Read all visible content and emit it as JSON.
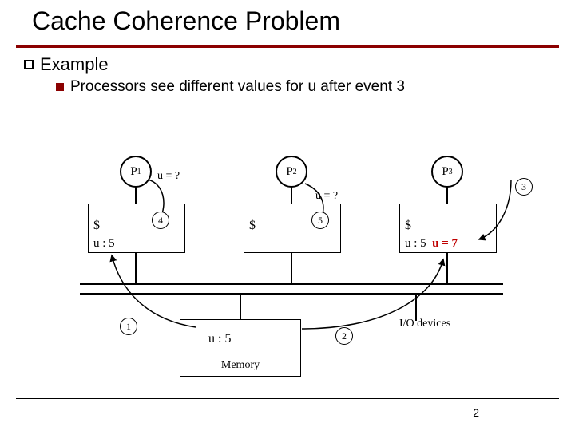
{
  "title": "Cache Coherence Problem",
  "bullets": {
    "example": "Example",
    "line": "Processors see different values for u after event 3"
  },
  "processors": {
    "p1": "P",
    "p1_sub": "1",
    "p2": "P",
    "p2_sub": "2",
    "p3": "P",
    "p3_sub": "3"
  },
  "caches": {
    "dollar": "$",
    "c1_val": "u : 5",
    "c3_val": "u : 5",
    "c3_extra": "u = 7"
  },
  "queries": {
    "q1": "u = ?",
    "q2": "u = ?"
  },
  "events": {
    "e1": "1",
    "e2": "2",
    "e3": "3",
    "e4": "4",
    "e5": "5"
  },
  "memory": {
    "line": "u : 5",
    "caption": "Memory"
  },
  "io": "I/O devices",
  "page": "2"
}
